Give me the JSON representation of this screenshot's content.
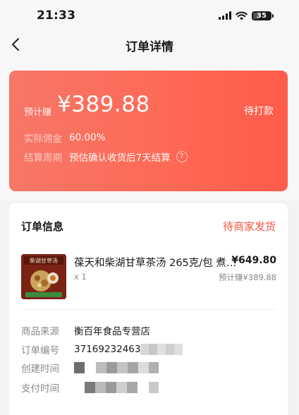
{
  "status_bar": {
    "time": "21:33",
    "battery": "35"
  },
  "nav": {
    "title": "订单详情"
  },
  "earnings": {
    "label": "预计赚",
    "amount": "¥389.88",
    "status": "待打款",
    "commission_key": "实际佣金",
    "commission_val": "60.00%",
    "cycle_key": "结算周期",
    "cycle_val": "预估确认收货后7天结算"
  },
  "order": {
    "title": "订单信息",
    "status": "待商家发货",
    "product": {
      "thumb_text": "柴湖甘草汤",
      "name": "葆天和柴湖甘草茶汤 265克/包 煮水...",
      "price": "¥649.80",
      "qty": "x 1",
      "earn": "预计赚¥389.88"
    },
    "details": [
      {
        "key": "商品来源",
        "value": "衡百年食品专营店"
      },
      {
        "key": "订单编号",
        "value": "37169232463"
      },
      {
        "key": "创建时间",
        "value": ""
      },
      {
        "key": "支付时间",
        "value": ""
      }
    ]
  },
  "colors": {
    "accent": "#f5533e",
    "card_start": "#f77768",
    "card_end": "#ff5b4a"
  }
}
